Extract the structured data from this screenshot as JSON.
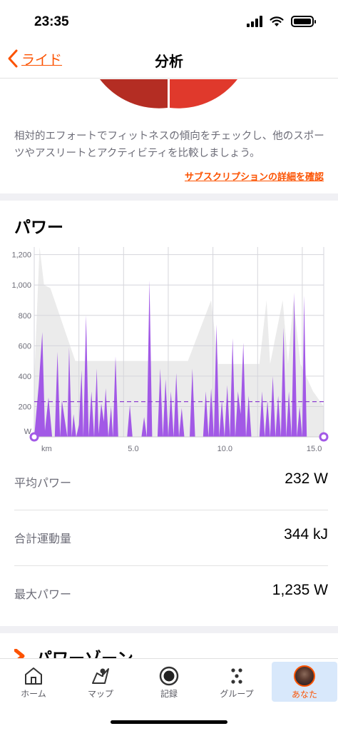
{
  "status_bar": {
    "time": "23:35"
  },
  "nav": {
    "back_label": "ライド",
    "title": "分析"
  },
  "effort": {
    "description": "相対的エフォートでフィットネスの傾向をチェックし、他のスポーツやアスリートとアクティビティを比較しましょう。",
    "subscription_link": "サブスクリプションの詳細を確認"
  },
  "power": {
    "title": "パワー",
    "stats": [
      {
        "label": "平均パワー",
        "value": "232 W"
      },
      {
        "label": "合計運動量",
        "value": "344 kJ"
      },
      {
        "label": "最大パワー",
        "value": "1,235 W"
      }
    ]
  },
  "power_zones": {
    "title": "パワーゾーン"
  },
  "tabs": [
    {
      "label": "ホーム",
      "icon": "home-icon"
    },
    {
      "label": "マップ",
      "icon": "map-icon"
    },
    {
      "label": "記録",
      "icon": "record-icon"
    },
    {
      "label": "グループ",
      "icon": "group-icon"
    },
    {
      "label": "あなた",
      "icon": "avatar"
    }
  ],
  "colors": {
    "accent": "#fc5200",
    "power": "#a259e6",
    "elevation": "#ebebeb"
  },
  "chart_data": {
    "type": "area",
    "title": "",
    "xlabel": "km",
    "ylabel": "W",
    "xlim": [
      0,
      16.2
    ],
    "ylim": [
      0,
      1250
    ],
    "x_ticks": [
      5,
      10,
      15
    ],
    "x_tick_labels": [
      "5.0",
      "10.0",
      "15.0"
    ],
    "y_ticks": [
      200,
      400,
      600,
      800,
      1000,
      1200
    ],
    "y_tick_labels": [
      "200",
      "400",
      "600",
      "800",
      "1,000",
      "1,200"
    ],
    "average_line": 232,
    "grid": true,
    "series": [
      {
        "kind": "power",
        "x": [
          0,
          0.25,
          0.45,
          0.6,
          0.8,
          1.0,
          1.15,
          1.3,
          1.45,
          1.55,
          1.7,
          1.85,
          1.95,
          2.1,
          2.2,
          2.35,
          2.5,
          2.65,
          2.75,
          2.9,
          3.05,
          3.2,
          3.35,
          3.5,
          3.6,
          3.75,
          3.9,
          4.0,
          4.15,
          4.3,
          4.4,
          4.55,
          4.7,
          4.8,
          5.0,
          5.2,
          5.35,
          5.5,
          5.7,
          5.85,
          6.0,
          6.15,
          6.3,
          6.45,
          6.6,
          6.75,
          6.9,
          7.05,
          7.2,
          7.35,
          7.5,
          7.65,
          7.8,
          7.95,
          8.1,
          8.25,
          8.4,
          8.55,
          8.7,
          8.85,
          9.0,
          9.15,
          9.3,
          9.45,
          9.6,
          9.75,
          9.9,
          10.05,
          10.2,
          10.35,
          10.5,
          10.65,
          10.8,
          10.95,
          11.1,
          11.25,
          11.4,
          11.55,
          11.7,
          11.85,
          12.0,
          12.15,
          12.3,
          12.45,
          12.6,
          12.75,
          12.9,
          13.05,
          13.2,
          13.35,
          13.5,
          13.65,
          13.8,
          13.95,
          14.1,
          14.25,
          14.4,
          14.55,
          14.7,
          14.85,
          15.0,
          15.1,
          15.25,
          15.4,
          15.55,
          15.7,
          15.85,
          16.0,
          16.2
        ],
        "y": [
          0,
          340,
          690,
          40,
          260,
          0,
          0,
          560,
          0,
          240,
          120,
          0,
          590,
          0,
          150,
          0,
          80,
          440,
          0,
          800,
          0,
          300,
          0,
          450,
          20,
          220,
          100,
          320,
          0,
          200,
          0,
          530,
          0,
          0,
          0,
          0,
          210,
          0,
          0,
          0,
          0,
          130,
          0,
          1030,
          0,
          0,
          0,
          450,
          0,
          380,
          0,
          300,
          0,
          420,
          0,
          190,
          0,
          0,
          0,
          450,
          0,
          0,
          0,
          0,
          300,
          0,
          320,
          0,
          740,
          0,
          240,
          0,
          340,
          0,
          650,
          0,
          300,
          150,
          620,
          0,
          270,
          0,
          0,
          0,
          0,
          300,
          0,
          240,
          0,
          400,
          0,
          270,
          0,
          720,
          0,
          300,
          0,
          950,
          0,
          200,
          0,
          930,
          0,
          0,
          0,
          0,
          0,
          0,
          0
        ],
        "color": "#a259e6"
      },
      {
        "kind": "elevation",
        "x": [
          0,
          0.3,
          0.3,
          0.55,
          0.55,
          0.9,
          0.9,
          2.3,
          2.3,
          5.6,
          5.6,
          7.4,
          7.4,
          8.6,
          8.6,
          9.9,
          9.9,
          10.3,
          10.3,
          11.6,
          11.6,
          12.6,
          12.6,
          13.0,
          13.0,
          13.2,
          13.2,
          13.9,
          13.9,
          14.2,
          14.2,
          14.5,
          14.5,
          14.9,
          14.9,
          15.6,
          15.6,
          16.2
        ],
        "y": [
          380,
          1400,
          1400,
          1000,
          1000,
          980,
          980,
          500,
          500,
          500,
          500,
          500,
          500,
          500,
          500,
          900,
          900,
          480,
          480,
          480,
          480,
          480,
          480,
          900,
          900,
          480,
          480,
          900,
          900,
          480,
          480,
          900,
          900,
          480,
          480,
          300,
          300,
          200
        ],
        "color": "#ebebeb"
      }
    ]
  }
}
